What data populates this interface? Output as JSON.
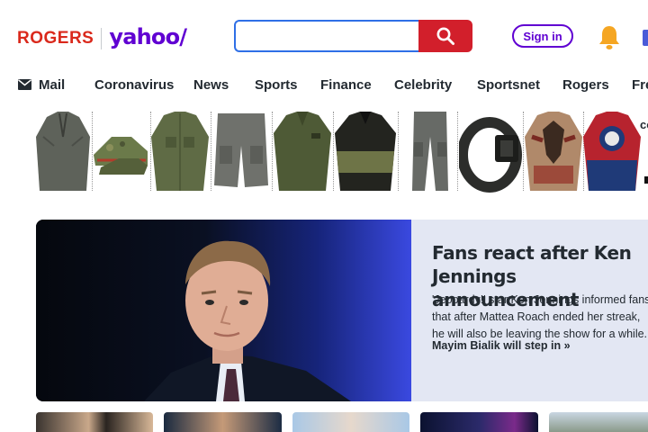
{
  "header": {
    "logo_rogers": "ROGERS",
    "logo_yahoo": "yahoo/",
    "search": {
      "placeholder": "",
      "value": ""
    },
    "signin_label": "Sign in"
  },
  "nav": {
    "items": [
      {
        "label": "Mail"
      },
      {
        "label": "Coronavirus"
      },
      {
        "label": "News"
      },
      {
        "label": "Sports"
      },
      {
        "label": "Finance"
      },
      {
        "label": "Celebrity"
      },
      {
        "label": "Sportsnet"
      },
      {
        "label": "Rogers"
      },
      {
        "label": "Fre"
      }
    ]
  },
  "ads": {
    "side_text": "co"
  },
  "hero": {
    "title": "Fans react after Ken Jennings announcement",
    "description": "'Jeopardy!' star Ken Jennings informed fans that after Mattea Roach ended her streak, he will also be leaving the show for a while.",
    "link": "Mayim Bialik will step in »"
  },
  "colors": {
    "rogers_red": "#da291c",
    "yahoo_purple": "#6001d2",
    "search_red": "#d21f2b",
    "search_border": "#2f6fe6"
  }
}
